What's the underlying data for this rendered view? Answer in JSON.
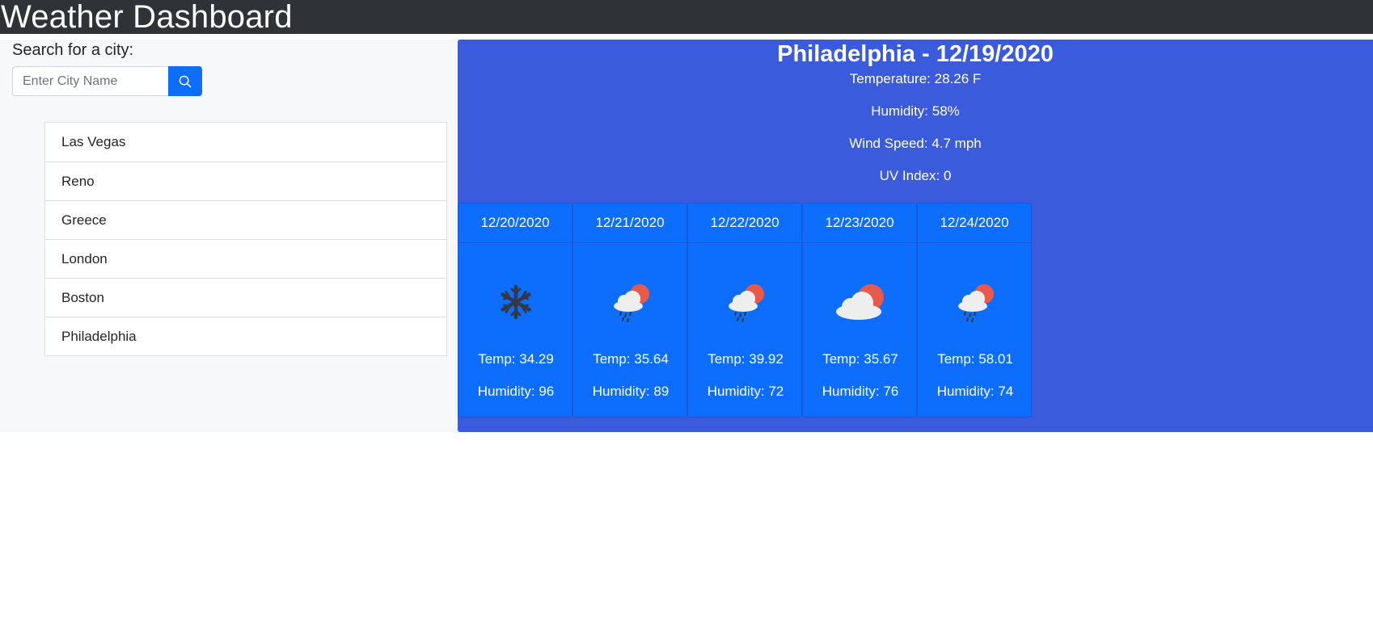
{
  "header": {
    "title": "Weather Dashboard"
  },
  "search": {
    "label": "Search for a city:",
    "placeholder": "Enter City Name",
    "button_icon": "search-icon"
  },
  "history": [
    "Las Vegas",
    "Reno",
    "Greece",
    "London",
    "Boston",
    "Philadelphia"
  ],
  "current": {
    "title": "Philadelphia - 12/19/2020",
    "temperature": "Temperature: 28.26 F",
    "humidity": "Humidity: 58%",
    "wind": "Wind Speed: 4.7 mph",
    "uv": "UV Index: 0"
  },
  "forecast": [
    {
      "date": "12/20/2020",
      "icon": "snowflake-icon",
      "temp": "Temp: 34.29",
      "humidity": "Humidity: 96"
    },
    {
      "date": "12/21/2020",
      "icon": "sun-rain-cloud-icon",
      "temp": "Temp: 35.64",
      "humidity": "Humidity: 89"
    },
    {
      "date": "12/22/2020",
      "icon": "sun-rain-cloud-icon",
      "temp": "Temp: 39.92",
      "humidity": "Humidity: 72"
    },
    {
      "date": "12/23/2020",
      "icon": "sun-cloud-icon",
      "temp": "Temp: 35.67",
      "humidity": "Humidity: 76"
    },
    {
      "date": "12/24/2020",
      "icon": "sun-rain-cloud-icon",
      "temp": "Temp: 58.01",
      "humidity": "Humidity: 74"
    }
  ],
  "colors": {
    "navbar": "#2f3236",
    "current_bg": "#3a5bdb",
    "card_bg": "#0d6efd",
    "button": "#0d6efd"
  }
}
